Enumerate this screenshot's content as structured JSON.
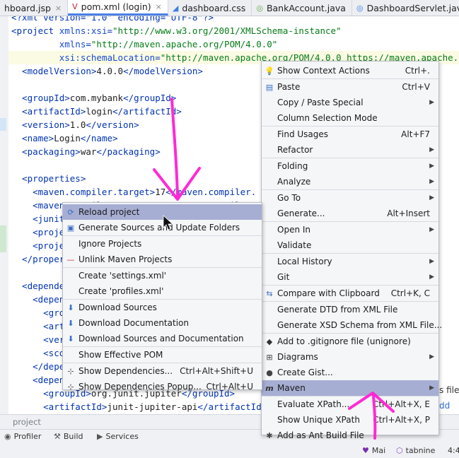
{
  "tabs": [
    {
      "label": "hboard.jsp",
      "icon": "jsp-icon",
      "icon_color": "#d35f00",
      "active": false
    },
    {
      "label": "pom.xml (login)",
      "icon": "maven-icon",
      "icon_color": "#c71a36",
      "active": true
    },
    {
      "label": "dashboard.css",
      "icon": "css-icon",
      "icon_color": "#3d7de0",
      "active": false
    },
    {
      "label": "BankAccount.java",
      "icon": "class-icon",
      "icon_color": "#6aa84f",
      "active": false
    },
    {
      "label": "DashboardServlet.java",
      "icon": "class-icon",
      "icon_color": "#3d7de0",
      "active": false
    }
  ],
  "editor": {
    "lines": [
      {
        "parts": [
          [
            "tag",
            "<?xml version=\"1.0\" encoding=\"UTF-8\"?>"
          ]
        ]
      },
      {
        "parts": [
          [
            "tag",
            "<project "
          ],
          [
            "attr",
            "xmlns:xsi"
          ],
          [
            "tag",
            "="
          ],
          [
            "val",
            "\"http://www.w3.org/2001/XMLSchema-instance\""
          ]
        ]
      },
      {
        "parts": [
          [
            "tag",
            "         "
          ],
          [
            "attr",
            "xmlns"
          ],
          [
            "tag",
            "="
          ],
          [
            "val",
            "\"http://maven.apache.org/POM/4.0.0\""
          ]
        ]
      },
      {
        "parts": [
          [
            "tag",
            "         "
          ],
          [
            "attr",
            "xsi:schemaLocation"
          ],
          [
            "tag",
            "="
          ],
          [
            "val",
            "\"http://maven.apache.org/POM/4.0.0 https://maven.apache.o"
          ]
        ]
      },
      {
        "parts": [
          [
            "tag",
            "  <modelVersion>"
          ],
          [
            "txt",
            "4.0.0"
          ],
          [
            "tag",
            "</modelVersion>"
          ]
        ]
      },
      {
        "parts": [
          [
            "txt",
            ""
          ]
        ]
      },
      {
        "parts": [
          [
            "tag",
            "  <groupId>"
          ],
          [
            "txt",
            "com.mybank"
          ],
          [
            "tag",
            "</groupId>"
          ]
        ]
      },
      {
        "parts": [
          [
            "tag",
            "  <artifactId>"
          ],
          [
            "txt",
            "login"
          ],
          [
            "tag",
            "</artifactId>"
          ]
        ]
      },
      {
        "parts": [
          [
            "tag",
            "  <version>"
          ],
          [
            "txt",
            "1.0"
          ],
          [
            "tag",
            "</version>"
          ]
        ]
      },
      {
        "parts": [
          [
            "tag",
            "  <name>"
          ],
          [
            "txt",
            "Login"
          ],
          [
            "tag",
            "</name>"
          ]
        ]
      },
      {
        "parts": [
          [
            "tag",
            "  <packaging>"
          ],
          [
            "txt",
            "war"
          ],
          [
            "tag",
            "</packaging>"
          ]
        ]
      },
      {
        "parts": [
          [
            "txt",
            ""
          ]
        ]
      },
      {
        "parts": [
          [
            "tag",
            "  <properties>"
          ]
        ]
      },
      {
        "parts": [
          [
            "tag",
            "    <maven.compiler.target>"
          ],
          [
            "txt",
            "17"
          ],
          [
            "tag",
            "</maven.compiler."
          ]
        ]
      },
      {
        "parts": [
          [
            "tag",
            "    <maven.compiler.source>"
          ],
          [
            "txt",
            "17"
          ],
          [
            "tag",
            "</maven.compile"
          ]
        ]
      },
      {
        "parts": [
          [
            "tag",
            "    <junit"
          ]
        ]
      },
      {
        "parts": [
          [
            "tag",
            "    <proje"
          ]
        ]
      },
      {
        "parts": [
          [
            "tag",
            "    <proje"
          ]
        ]
      },
      {
        "parts": [
          [
            "tag",
            "  </proper"
          ]
        ]
      },
      {
        "parts": [
          [
            "txt",
            ""
          ]
        ]
      },
      {
        "parts": [
          [
            "tag",
            "  <depende"
          ]
        ]
      },
      {
        "parts": [
          [
            "tag",
            "    <depen"
          ]
        ]
      },
      {
        "parts": [
          [
            "tag",
            "      <gro"
          ]
        ]
      },
      {
        "parts": [
          [
            "tag",
            "      <art"
          ]
        ]
      },
      {
        "parts": [
          [
            "tag",
            "      <ver"
          ]
        ]
      },
      {
        "parts": [
          [
            "tag",
            "      <sco"
          ]
        ]
      },
      {
        "parts": [
          [
            "tag",
            "    </depe"
          ]
        ]
      },
      {
        "parts": [
          [
            "tag",
            "    <depen"
          ]
        ]
      },
      {
        "parts": [
          [
            "tag",
            "      <groupId>"
          ],
          [
            "txt",
            "org.junit.jupiter"
          ],
          [
            "tag",
            "</groupId>"
          ]
        ]
      },
      {
        "parts": [
          [
            "tag",
            "      <artifactId>"
          ],
          [
            "txt",
            "junit-jupiter-api"
          ],
          [
            "tag",
            "</artifactId>"
          ]
        ]
      }
    ]
  },
  "tool_tabs": {
    "label": "project"
  },
  "bottom_bar": {
    "profiler": "Profiler",
    "build": "Build",
    "services": "Services",
    "heart": "Mai",
    "tabnine": "tabnine",
    "time": "4:4"
  },
  "context_menu": {
    "items": [
      {
        "label": "Show Context Actions",
        "shortcut": "Ctrl+.",
        "icon": "bulb-icon",
        "arrow": false
      },
      {
        "sep": true
      },
      {
        "label": "Paste",
        "shortcut": "Ctrl+V",
        "icon": "paste-icon",
        "arrow": false
      },
      {
        "label": "Copy / Paste Special",
        "shortcut": "",
        "icon": "",
        "arrow": true
      },
      {
        "label": "Column Selection Mode",
        "shortcut": "",
        "icon": "",
        "arrow": false
      },
      {
        "sep": true
      },
      {
        "label": "Find Usages",
        "shortcut": "Alt+F7",
        "icon": "",
        "arrow": false
      },
      {
        "label": "Refactor",
        "shortcut": "",
        "icon": "",
        "arrow": true
      },
      {
        "sep": true
      },
      {
        "label": "Folding",
        "shortcut": "",
        "icon": "",
        "arrow": true
      },
      {
        "label": "Analyze",
        "shortcut": "",
        "icon": "",
        "arrow": true
      },
      {
        "sep": true
      },
      {
        "label": "Go To",
        "shortcut": "",
        "icon": "",
        "arrow": true
      },
      {
        "label": "Generate...",
        "shortcut": "Alt+Insert",
        "icon": "",
        "arrow": false
      },
      {
        "sep": true
      },
      {
        "label": "Open In",
        "shortcut": "",
        "icon": "",
        "arrow": true
      },
      {
        "label": "Validate",
        "shortcut": "",
        "icon": "",
        "arrow": false
      },
      {
        "sep": true
      },
      {
        "label": "Local History",
        "shortcut": "",
        "icon": "",
        "arrow": true
      },
      {
        "label": "Git",
        "shortcut": "",
        "icon": "",
        "arrow": true
      },
      {
        "sep": true
      },
      {
        "label": "Compare with Clipboard",
        "shortcut": "Ctrl+K, C",
        "icon": "compare-icon",
        "arrow": false
      },
      {
        "sep": true
      },
      {
        "label": "Generate DTD from XML File",
        "shortcut": "",
        "icon": "",
        "arrow": false
      },
      {
        "label": "Generate XSD Schema from XML File...",
        "shortcut": "",
        "icon": "",
        "arrow": false
      },
      {
        "sep": true
      },
      {
        "label": "Add to .gitignore file (unignore)",
        "shortcut": "",
        "icon": "gitignore-icon",
        "arrow": false
      },
      {
        "label": "Diagrams",
        "shortcut": "",
        "icon": "diagram-icon",
        "arrow": true
      },
      {
        "label": "Create Gist...",
        "shortcut": "",
        "icon": "github-icon",
        "arrow": false
      },
      {
        "label": "Maven",
        "shortcut": "",
        "icon": "maven-m-icon",
        "arrow": true,
        "selected": true
      },
      {
        "sep": true
      },
      {
        "label": "Evaluate XPath...",
        "shortcut": "Ctrl+Alt+X, E",
        "icon": "",
        "arrow": false
      },
      {
        "label": "Show Unique XPath",
        "shortcut": "Ctrl+Alt+X, P",
        "icon": "",
        "arrow": false
      },
      {
        "label": "Add as Ant Build File",
        "shortcut": "",
        "icon": "ant-icon",
        "arrow": false
      }
    ]
  },
  "maven_menu": {
    "items": [
      {
        "label": "Reload project",
        "shortcut": "",
        "icon": "reload-icon",
        "selected": true
      },
      {
        "label": "Generate Sources and Update Folders",
        "shortcut": "",
        "icon": "folder-gen-icon"
      },
      {
        "sep": true
      },
      {
        "label": "Ignore Projects",
        "shortcut": "",
        "icon": ""
      },
      {
        "label": "Unlink Maven Projects",
        "shortcut": "",
        "icon": "minus-icon"
      },
      {
        "sep": true
      },
      {
        "label": "Create 'settings.xml'",
        "shortcut": "",
        "icon": ""
      },
      {
        "label": "Create 'profiles.xml'",
        "shortcut": "",
        "icon": ""
      },
      {
        "sep": true
      },
      {
        "label": "Download Sources",
        "shortcut": "",
        "icon": "download-icon"
      },
      {
        "label": "Download Documentation",
        "shortcut": "",
        "icon": "download-icon"
      },
      {
        "label": "Download Sources and Documentation",
        "shortcut": "",
        "icon": "download-icon"
      },
      {
        "sep": true
      },
      {
        "label": "Show Effective POM",
        "shortcut": "",
        "icon": ""
      },
      {
        "sep": true
      },
      {
        "label": "Show Dependencies...",
        "shortcut": "Ctrl+Alt+Shift+U",
        "icon": "dependencies-icon"
      },
      {
        "label": "Show Dependencies Popup...",
        "shortcut": "Ctrl+Alt+U",
        "icon": "dependencies-icon"
      }
    ]
  },
  "side_note": {
    "line1": "s files",
    "line2": "dd"
  },
  "colors": {
    "accent": "#a7aed3",
    "annotation": "#ff2ad4",
    "active_tab": "#4a80e8"
  }
}
